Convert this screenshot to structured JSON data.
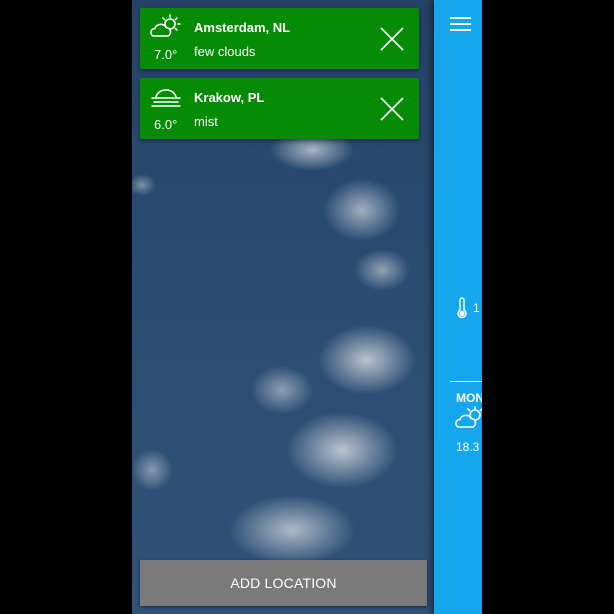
{
  "locations": [
    {
      "icon": "few-clouds-icon",
      "temp": "7.0°",
      "city": "Amsterdam, NL",
      "condition": "few clouds"
    },
    {
      "icon": "mist-icon",
      "temp": "6.0°",
      "city": "Krakow, PL",
      "condition": "mist"
    }
  ],
  "add_location_label": "ADD LOCATION",
  "main": {
    "current_temp": "1",
    "forecast_day": "MON",
    "forecast_temp": "18.3"
  },
  "colors": {
    "card": "#068b06",
    "panel": "#15a7ed",
    "button": "#7a7a7a"
  }
}
